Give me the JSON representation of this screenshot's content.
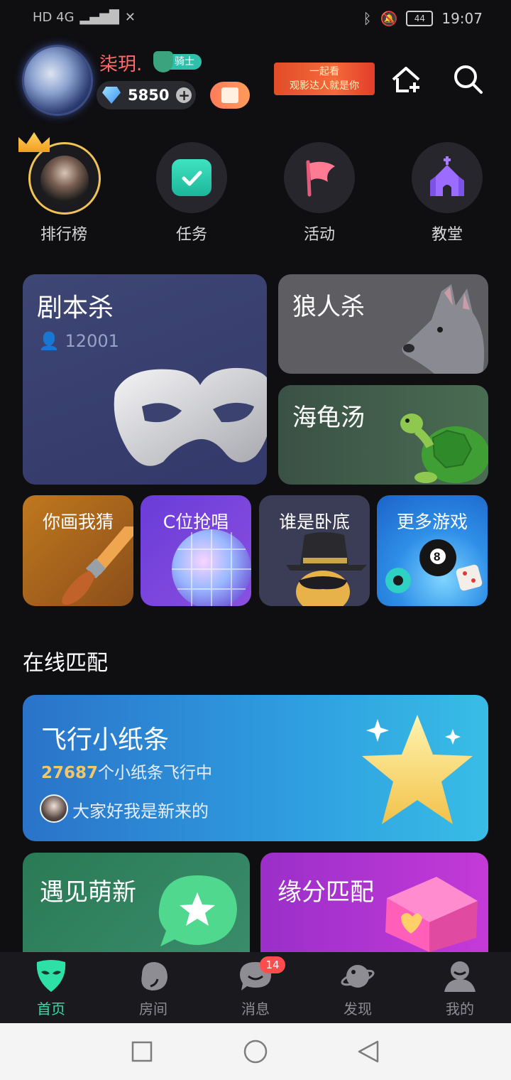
{
  "status_bar": {
    "left": "HD 4G",
    "battery": "44",
    "time": "19:07"
  },
  "header": {
    "username": "柒玥.",
    "badge": "骑士",
    "diamond_count": "5850",
    "banner_line1": "一起看",
    "banner_line2": "观影达人就是你"
  },
  "quick_nav": {
    "items": [
      {
        "label": "排行榜"
      },
      {
        "label": "任务"
      },
      {
        "label": "活动"
      },
      {
        "label": "教堂"
      }
    ]
  },
  "games": {
    "script_kill": {
      "title": "剧本杀",
      "count": "12001"
    },
    "werewolf": {
      "title": "狼人杀"
    },
    "turtle_soup": {
      "title": "海龟汤"
    },
    "small": [
      {
        "title": "你画我猜"
      },
      {
        "title": "C位抢唱"
      },
      {
        "title": "谁是卧底"
      },
      {
        "title": "更多游戏"
      }
    ]
  },
  "online_match": {
    "title": "在线匹配",
    "paper_plane": {
      "title": "飞行小纸条",
      "count": "27687",
      "count_suffix": "个小纸条飞行中",
      "message": "大家好我是新来的"
    },
    "meet": {
      "title": "遇见萌新"
    },
    "fate": {
      "title": "缘分匹配"
    }
  },
  "tabbar": {
    "items": [
      {
        "label": "首页"
      },
      {
        "label": "房间"
      },
      {
        "label": "消息"
      },
      {
        "label": "发现"
      },
      {
        "label": "我的"
      }
    ],
    "message_badge": "14"
  },
  "colors": {
    "active_tab": "#2ee0a5",
    "username": "#ff6a6a",
    "count_highlight": "#f2c66a"
  }
}
